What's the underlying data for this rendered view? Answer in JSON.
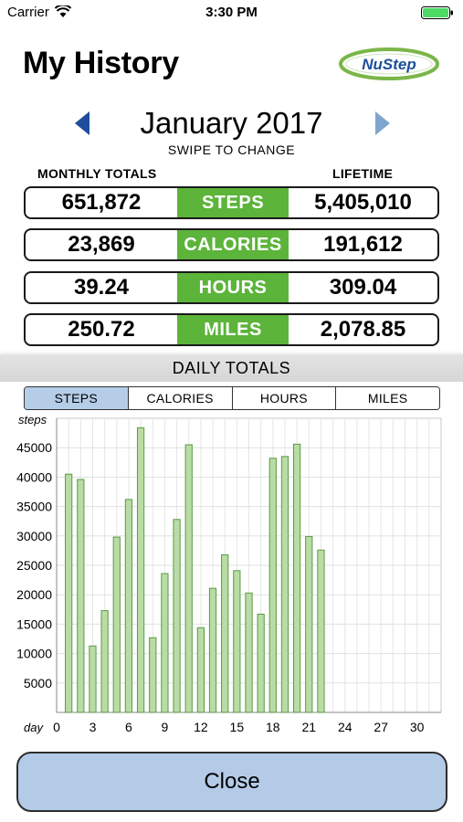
{
  "status_bar": {
    "carrier": "Carrier",
    "time": "3:30 PM",
    "icons": [
      "wifi-icon",
      "battery-icon"
    ],
    "battery_level": 1.0
  },
  "header": {
    "title": "My History",
    "logo_text": "NuStep",
    "logo_colors": {
      "outline": "#7ab648",
      "text": "#1d4e9b"
    }
  },
  "month_nav": {
    "label": "January 2017",
    "hint": "SWIPE TO CHANGE",
    "prev_icon": "left-triangle-icon",
    "next_icon": "right-triangle-icon"
  },
  "totals": {
    "monthly_header": "MONTHLY TOTALS",
    "lifetime_header": "LIFETIME",
    "rows": [
      {
        "label": "STEPS",
        "monthly": "651,872",
        "lifetime": "5,405,010"
      },
      {
        "label": "CALORIES",
        "monthly": "23,869",
        "lifetime": "191,612"
      },
      {
        "label": "HOURS",
        "monthly": "39.24",
        "lifetime": "309.04"
      },
      {
        "label": "MILES",
        "monthly": "250.72",
        "lifetime": "2,078.85"
      }
    ]
  },
  "daily": {
    "header": "DAILY TOTALS",
    "tabs": [
      "STEPS",
      "CALORIES",
      "HOURS",
      "MILES"
    ],
    "active_tab": 0
  },
  "colors": {
    "accent_green": "#5cb43a",
    "bar_fill": "#b9dca4",
    "bar_stroke": "#5a9a46",
    "button_blue": "#b3cbe7"
  },
  "chart_data": {
    "type": "bar",
    "ylabel": "steps",
    "xlabel": "day",
    "xlim": [
      0,
      32
    ],
    "ylim": [
      0,
      50000
    ],
    "grid": true,
    "xticks": [
      0,
      3,
      6,
      9,
      12,
      15,
      18,
      21,
      24,
      27,
      30
    ],
    "yticks": [
      5000,
      10000,
      15000,
      20000,
      25000,
      30000,
      35000,
      40000,
      45000
    ],
    "x": [
      1,
      2,
      3,
      4,
      5,
      6,
      7,
      8,
      9,
      10,
      11,
      12,
      13,
      14,
      15,
      16,
      17,
      18,
      19,
      20,
      21,
      22
    ],
    "values": [
      40500,
      39600,
      11300,
      17300,
      29800,
      36200,
      48400,
      12700,
      23600,
      32800,
      45500,
      14400,
      21100,
      26800,
      24100,
      20300,
      16700,
      43200,
      43500,
      45600,
      29900,
      27600
    ]
  },
  "footer": {
    "close_label": "Close"
  }
}
